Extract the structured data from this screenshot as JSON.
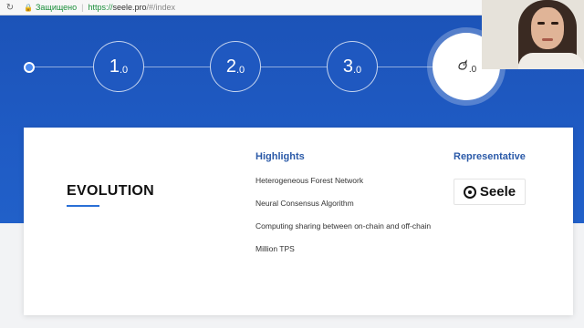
{
  "browser": {
    "secure_label": "Защищено",
    "url_scheme": "https://",
    "url_host": "seele.pro",
    "url_path": "/#/index"
  },
  "versions": [
    {
      "num": "1",
      "dec": ".0"
    },
    {
      "num": "2",
      "dec": ".0"
    },
    {
      "num": "3",
      "dec": ".0"
    }
  ],
  "active_version": {
    "icon": "bird-logo-icon",
    "dec": ".0"
  },
  "card": {
    "title": "EVOLUTION",
    "highlights_title": "Highlights",
    "highlights": [
      "Heterogeneous Forest Network",
      "Neural Consensus Algorithm",
      "Computing sharing between on-chain and off-chain",
      "Million TPS"
    ],
    "representative_title": "Representative",
    "representative_logo": "Seele"
  },
  "colors": {
    "hero_blue": "#1f5bc4",
    "accent_title": "#2b5aa8",
    "underline": "#2a6fd6"
  }
}
